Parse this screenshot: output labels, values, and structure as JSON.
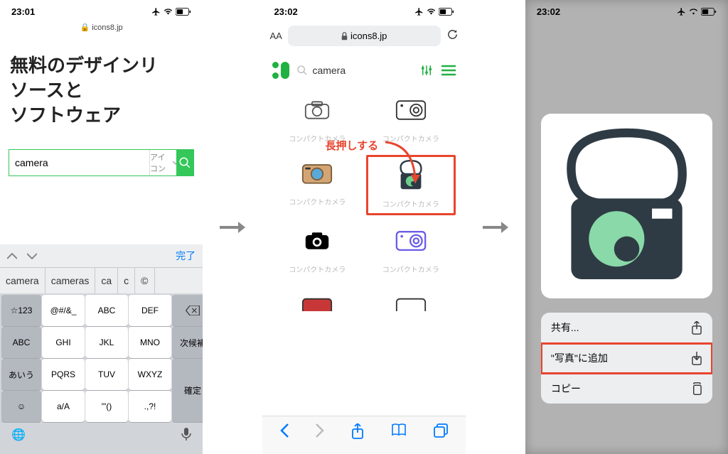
{
  "screen1": {
    "time": "23:01",
    "domain": "icons8.jp",
    "headline_l1": "無料のデザインリ",
    "headline_l2": "ソースと",
    "headline_l3": "ソフトウェア",
    "search_value": "camera",
    "search_category": "アイコン",
    "kb_done": "完了",
    "suggestions": [
      "camera",
      "cameras",
      "ca",
      "c",
      "©"
    ],
    "keys": {
      "r1": [
        "☆123",
        "@#/&_",
        "ABC",
        "DEF"
      ],
      "r2": [
        "ABC",
        "GHI",
        "JKL",
        "MNO",
        "次候補"
      ],
      "r3": [
        "あいう",
        "PQRS",
        "TUV",
        "WXYZ"
      ],
      "r4": [
        "",
        "a/A",
        "'\"()",
        ".,?!",
        "確定"
      ]
    }
  },
  "screen2": {
    "time": "23:02",
    "domain": "icons8.jp",
    "search_value": "camera",
    "annotation": "長押しする",
    "icon_label": "コンパクトカメラ"
  },
  "screen3": {
    "time": "23:02",
    "menu": {
      "share": "共有...",
      "add_photos": "\"写真\"に追加",
      "copy": "コピー"
    }
  }
}
